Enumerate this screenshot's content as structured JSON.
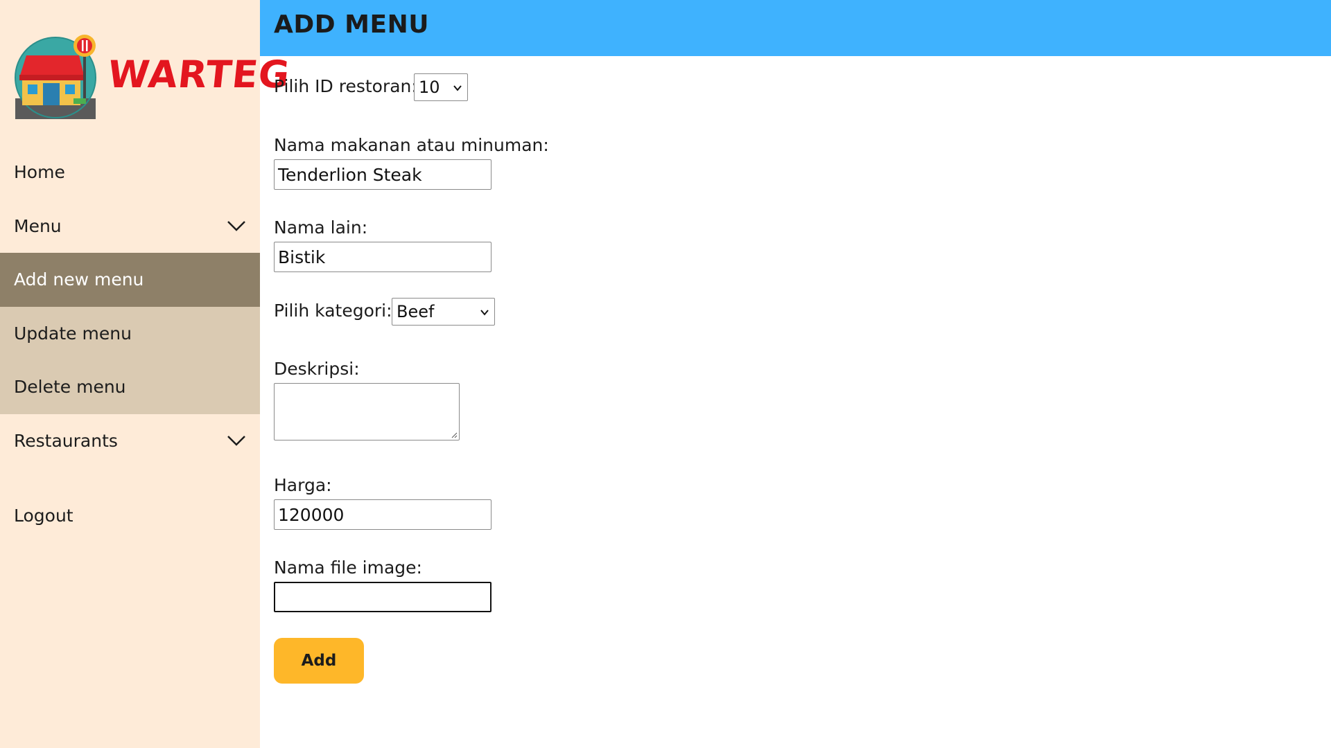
{
  "sidebar": {
    "logo_text": "WARTEG",
    "items": [
      {
        "label": "Home"
      },
      {
        "label": "Menu"
      },
      {
        "label": "Add new menu"
      },
      {
        "label": "Update menu"
      },
      {
        "label": "Delete menu"
      },
      {
        "label": "Restaurants"
      }
    ],
    "logout": "Logout"
  },
  "header": {
    "title": "ADD MENU"
  },
  "form": {
    "restaurant_label": "Pilih ID restoran:",
    "restaurant_value": "10",
    "name_label": "Nama makanan atau minuman:",
    "name_value": "Tenderlion Steak",
    "alt_name_label": "Nama lain:",
    "alt_name_value": "Bistik",
    "category_label": "Pilih kategori:",
    "category_value": "Beef",
    "description_label": "Deskripsi:",
    "description_value": "",
    "price_label": "Harga:",
    "price_value": "120000",
    "image_label": "Nama file image:",
    "image_value": "",
    "submit_label": "Add"
  },
  "colors": {
    "sidebar_bg": "#feebd8",
    "active_item_bg": "#8e8068",
    "submenu_bg": "#dacab2",
    "header_bg": "#3fb2fe",
    "button_bg": "#feb729",
    "logo_text": "#e3161f"
  }
}
